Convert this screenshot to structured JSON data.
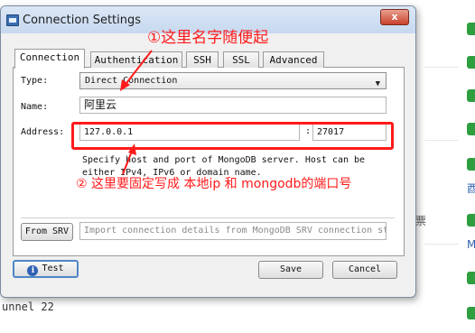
{
  "window": {
    "title": "Connection Settings",
    "close_label": "x"
  },
  "tabs": [
    {
      "label": "Connection",
      "active": true
    },
    {
      "label": "Authentication",
      "active": false
    },
    {
      "label": "SSH",
      "active": false
    },
    {
      "label": "SSL",
      "active": false
    },
    {
      "label": "Advanced",
      "active": false
    }
  ],
  "form": {
    "type_label": "Type:",
    "type_value": "Direct Connection",
    "name_label": "Name:",
    "name_value": "阿里云",
    "address_label": "Address:",
    "host_value": "127.0.0.1",
    "port_sep": ":",
    "port_value": "27017",
    "hint_line1": "Specify host and port of MongoDB server. Host can be",
    "hint_line2": "either IPv4, IPv6 or domain name.",
    "srv_button": "From SRV",
    "srv_placeholder": "Import connection details from MongoDB SRV connection string"
  },
  "buttons": {
    "test": "Test",
    "save": "Save",
    "cancel": "Cancel"
  },
  "annotations": {
    "note1": "①这里名字随便起",
    "note2": "② 这里要固定写成 本地ip 和 mongodb的端口号",
    "color": "#ff1a1a"
  },
  "background": {
    "bottom_text": "unnel 22",
    "right_char1": "票",
    "right_char2": "酉",
    "right_char3": "M"
  }
}
